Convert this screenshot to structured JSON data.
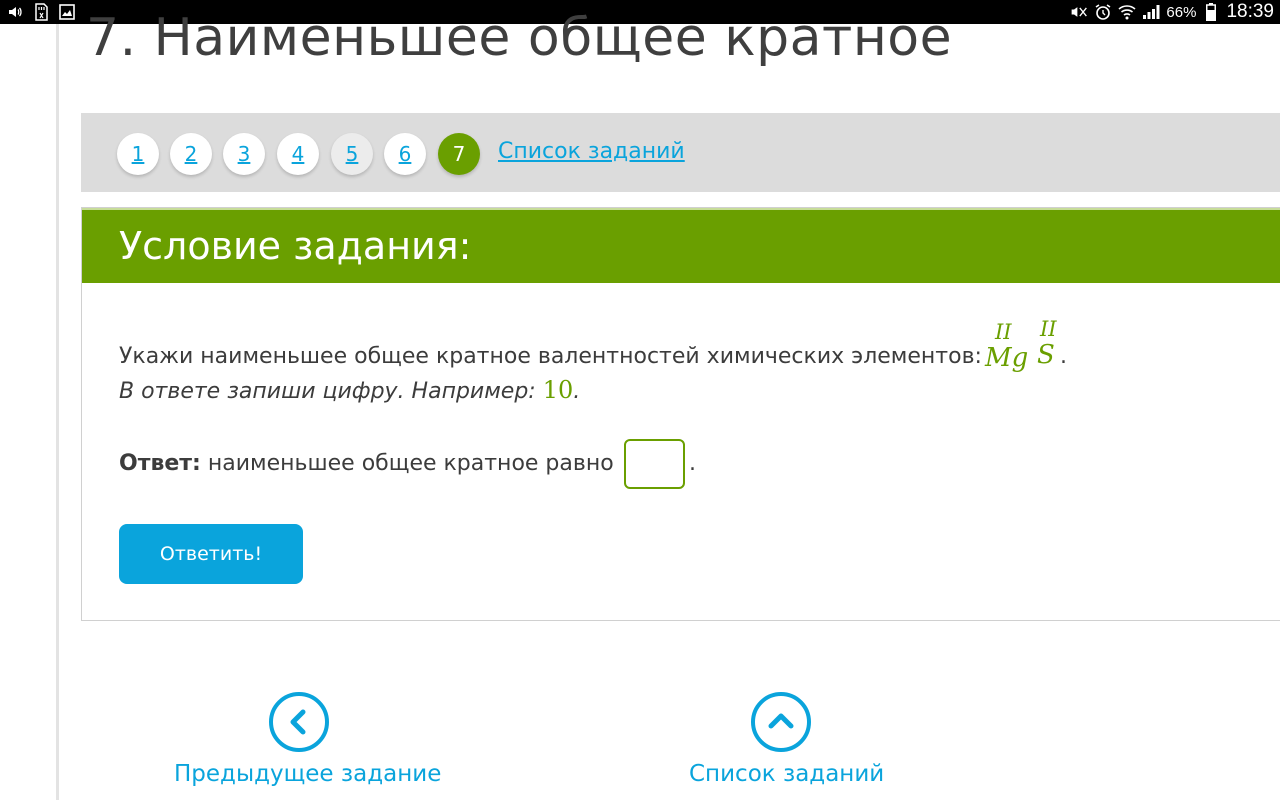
{
  "status_bar": {
    "battery_percent": "66%",
    "time": "18:39",
    "left_icons": [
      "volume-icon",
      "sd-card-icon",
      "gallery-icon"
    ],
    "right_icons": [
      "mute-icon",
      "alarm-icon",
      "wifi-icon",
      "signal-icon",
      "battery-icon"
    ]
  },
  "page": {
    "title": "7. Наименьшее общее кратное"
  },
  "pager": {
    "pages": [
      "1",
      "2",
      "3",
      "4",
      "5",
      "6",
      "7"
    ],
    "current": "7",
    "list_link": "Список заданий"
  },
  "task": {
    "header": "Условие задания:",
    "question_text": "Укажи наименьшее общее кратное валентностей химических элементов:",
    "element1_valence": "II",
    "element1_symbol": "Mg",
    "element2_valence": "II",
    "element2_symbol": "S",
    "question_end": ".",
    "instruction": "В ответе запиши цифру. Например:",
    "example_value": "10",
    "instruction_end": ".",
    "answer_label": "Ответ:",
    "answer_text": "наименьшее общее кратное равно",
    "answer_value": "",
    "answer_end": ".",
    "submit_label": "Ответить!"
  },
  "bottom_nav": {
    "prev_label": "Предыдущее задание",
    "list_label": "Список заданий"
  },
  "colors": {
    "green": "#6a9f00",
    "blue": "#0aa4dc",
    "gray_bar": "#dcdcdc"
  }
}
